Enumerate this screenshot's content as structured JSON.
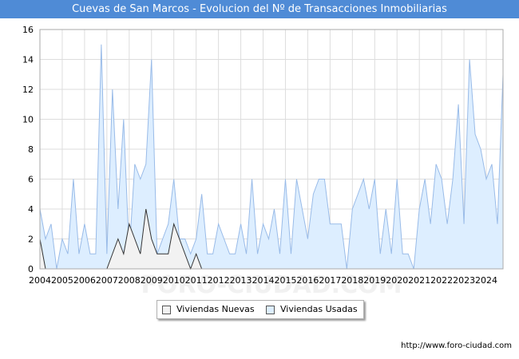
{
  "title": "Cuevas de San Marcos - Evolucion del Nº de Transacciones Inmobiliarias",
  "source": "http://www.foro-ciudad.com",
  "watermark": "FORO-CIUDAD.COM",
  "colors": {
    "title_bg": "#4f8bd6",
    "nuevas_fill": "#f2f2f2",
    "nuevas_line": "#333333",
    "usadas_fill": "#ddeeff",
    "usadas_line": "#99bbe8",
    "grid": "#dddddd"
  },
  "chart_data": {
    "type": "area",
    "title": "Cuevas de San Marcos - Evolucion del Nº de Transacciones Inmobiliarias",
    "x_start": 2004,
    "x_end": 2024.75,
    "x_step": 0.25,
    "xticks": [
      "2004",
      "2005",
      "2006",
      "2007",
      "2008",
      "2009",
      "2010",
      "2011",
      "2012",
      "2013",
      "2014",
      "2015",
      "2016",
      "2017",
      "2018",
      "2019",
      "2020",
      "2021",
      "2022",
      "2023",
      "2024"
    ],
    "ylim": [
      0,
      16
    ],
    "yticks": [
      0,
      2,
      4,
      6,
      8,
      10,
      12,
      14,
      16
    ],
    "grid": true,
    "legend_position": "bottom",
    "series": [
      {
        "name": "Viviendas Nuevas",
        "values": [
          2,
          0,
          0,
          0,
          0,
          0,
          0,
          0,
          0,
          0,
          0,
          0,
          0,
          1,
          2,
          1,
          3,
          2,
          1,
          4,
          2,
          1,
          1,
          1,
          3,
          2,
          1,
          0,
          1,
          0,
          0,
          0,
          0,
          0,
          0,
          0,
          0,
          0,
          0,
          0,
          0,
          0,
          0,
          0,
          0,
          0,
          0,
          0,
          0,
          0,
          0,
          0,
          0,
          0,
          0,
          0,
          0,
          0,
          0,
          0,
          0,
          0,
          0,
          0,
          0,
          0,
          0,
          0,
          0,
          0,
          0,
          0,
          0,
          0,
          0,
          0,
          0,
          0,
          0,
          0,
          0,
          0,
          0,
          0
        ]
      },
      {
        "name": "Viviendas Usadas",
        "values": [
          4,
          2,
          3,
          0,
          2,
          1,
          6,
          1,
          3,
          1,
          1,
          15,
          1,
          12,
          4,
          10,
          1,
          7,
          6,
          7,
          14,
          1,
          2,
          3,
          6,
          2,
          2,
          1,
          2,
          5,
          1,
          1,
          3,
          2,
          1,
          1,
          3,
          1,
          6,
          1,
          3,
          2,
          4,
          1,
          6,
          1,
          6,
          4,
          2,
          5,
          6,
          6,
          3,
          3,
          3,
          0,
          4,
          5,
          6,
          4,
          6,
          1,
          4,
          1,
          6,
          1,
          1,
          0,
          4,
          6,
          3,
          7,
          6,
          3,
          6,
          11,
          3,
          14,
          9,
          8,
          6,
          7,
          3,
          13
        ]
      }
    ]
  }
}
